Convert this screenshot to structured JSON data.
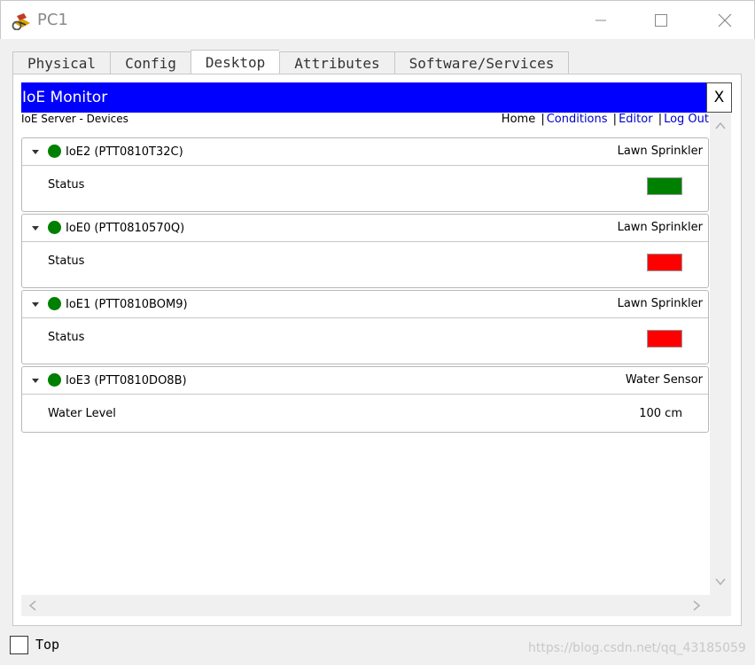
{
  "window": {
    "title": "PC1"
  },
  "tabs": [
    {
      "label": "Physical",
      "active": false
    },
    {
      "label": "Config",
      "active": false
    },
    {
      "label": "Desktop",
      "active": true
    },
    {
      "label": "Attributes",
      "active": false
    },
    {
      "label": "Software/Services",
      "active": false
    }
  ],
  "monitor": {
    "title": "IoE Monitor",
    "close_label": "X",
    "server_label": "IoE Server - Devices",
    "nav": {
      "home": "Home",
      "conditions": "Conditions",
      "editor": "Editor",
      "logout": "Log Out",
      "separator": "|"
    }
  },
  "devices": [
    {
      "name": "IoE2 (PTT0810T32C)",
      "type": "Lawn Sprinkler",
      "online_color": "#008000",
      "property": "Status",
      "value": "",
      "status_color": "#008000"
    },
    {
      "name": "IoE0 (PTT0810570Q)",
      "type": "Lawn Sprinkler",
      "online_color": "#008000",
      "property": "Status",
      "value": "",
      "status_color": "#ff0000"
    },
    {
      "name": "IoE1 (PTT0810BOM9)",
      "type": "Lawn Sprinkler",
      "online_color": "#008000",
      "property": "Status",
      "value": "",
      "status_color": "#ff0000"
    },
    {
      "name": "IoE3 (PTT0810DO8B)",
      "type": "Water Sensor",
      "online_color": "#008000",
      "property": "Water Level",
      "value": "100 cm",
      "status_color": ""
    }
  ],
  "footer": {
    "top_label": "Top",
    "top_checked": false,
    "watermark": "https://blog.csdn.net/qq_43185059"
  },
  "colors": {
    "header_blue": "#0000ff",
    "link_blue": "#0000cc",
    "on_green": "#008000",
    "off_red": "#ff0000"
  }
}
